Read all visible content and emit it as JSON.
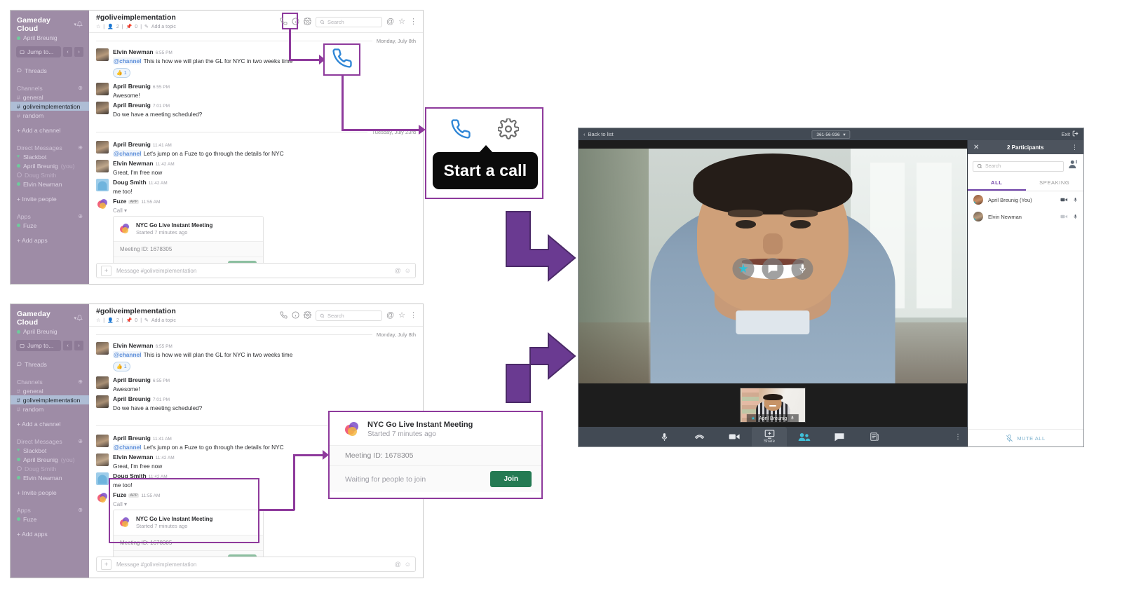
{
  "slack": {
    "team_name": "Gameday Cloud",
    "team_caret": "▾",
    "bell_icon": "🔔",
    "current_user": "April Breunig",
    "jump_placeholder": "Jump to...",
    "nav_prev": "‹",
    "nav_next": "›",
    "threads_label": "Threads",
    "sections": {
      "channels_label": "Channels",
      "channels": [
        {
          "hash": "#",
          "label": "general",
          "active": false
        },
        {
          "hash": "#",
          "label": "goliveimplementation",
          "active": true
        },
        {
          "hash": "#",
          "label": "random",
          "active": false
        }
      ],
      "add_channel": "+ Add a channel",
      "dm_label": "Direct Messages",
      "dms": [
        {
          "label": "Slackbot",
          "state": "heart"
        },
        {
          "label": "April Breunig",
          "suffix": "(you)",
          "state": "online"
        },
        {
          "label": "Doug Smith",
          "state": "away"
        },
        {
          "label": "Elvin Newman",
          "state": "online"
        }
      ],
      "invite_people": "+ Invite people",
      "apps_label": "Apps",
      "apps": [
        {
          "label": "Fuze",
          "state": "online"
        }
      ],
      "add_apps": "+ Add apps"
    },
    "channel": {
      "title": "#goliveimplementation",
      "members_icon": "☆",
      "member_count": "2",
      "pin_count": "0",
      "add_topic": "Add a topic",
      "search_placeholder": "Search",
      "call_icon": "phone-icon",
      "info_icon": "info-icon",
      "gear_icon": "gear-icon",
      "at_icon": "@",
      "star_icon": "☆",
      "kebab_icon": "⋮"
    },
    "day_dividers": {
      "first": "Monday, July 8th",
      "second": "Tuesday, July 23rd"
    },
    "messages_day1": [
      {
        "author": "Elvin Newman",
        "time": "6:55 PM",
        "mention": "@channel",
        "text": "This is how we will plan the GL for NYC in two weeks time",
        "reaction": {
          "emoji": "👍",
          "count": "1"
        }
      },
      {
        "author": "April Breunig",
        "time": "6:55 PM",
        "text": "Awesome!"
      },
      {
        "author": "April Breunig",
        "time": "7:01 PM",
        "text": "Do we have a meeting scheduled?"
      }
    ],
    "messages_day2": [
      {
        "author": "April Breunig",
        "time": "11:41 AM",
        "mention": "@channel",
        "text": "Let's jump on a Fuze to go through the details for NYC"
      },
      {
        "author": "Elvin Newman",
        "time": "11:42 AM",
        "text": "Great, I'm free now"
      },
      {
        "author": "Doug Smith",
        "time": "11:42 AM",
        "text": "me too!"
      },
      {
        "author": "Fuze",
        "app_tag": "APP",
        "time": "11:55 AM",
        "text": ""
      }
    ],
    "call_label": "Call ▾",
    "fuze_card": {
      "title": "NYC Go Live Instant Meeting",
      "subtitle": "Started 7 minutes ago",
      "meeting_id_label": "Meeting ID: 1678305",
      "waiting_label": "Waiting for people to join",
      "join_label": "Join"
    },
    "composer": {
      "placeholder": "Message #goliveimplementation",
      "plus": "+",
      "at": "@",
      "emoji": "☺"
    }
  },
  "callouts": {
    "tooltip_text": "Start a call",
    "tooltip_phone_icon": "phone-icon",
    "tooltip_gear_icon": "gear-icon",
    "zoom_phone_icon": "phone-icon"
  },
  "fuze_app": {
    "back_to_list": "Back to list",
    "back_chevron": "‹",
    "meeting_code": "361-56-936",
    "meeting_code_caret": "▾",
    "exit_label": "Exit",
    "exit_icon": "exit-icon",
    "stage_controls": [
      {
        "name": "favorite-star-button",
        "icon": "★"
      },
      {
        "name": "chat-bubble-button",
        "icon": "chat-icon"
      },
      {
        "name": "mic-button",
        "icon": "mic-icon"
      }
    ],
    "thumbnail": {
      "name": "April Breunig",
      "star": "★",
      "mic_icon": "mic-icon"
    },
    "toolbar": [
      {
        "name": "mic-toolbar-button",
        "icon": "mic-icon",
        "label": ""
      },
      {
        "name": "hangup-toolbar-button",
        "icon": "hangup-icon",
        "label": ""
      },
      {
        "name": "camera-toolbar-button",
        "icon": "camera-icon",
        "label": ""
      },
      {
        "name": "share-toolbar-button",
        "icon": "share-icon",
        "label": "Share"
      },
      {
        "name": "participants-toolbar-button",
        "icon": "people-icon",
        "label": ""
      },
      {
        "name": "chat-toolbar-button",
        "icon": "chat-icon",
        "label": ""
      },
      {
        "name": "notes-toolbar-button",
        "icon": "notes-icon",
        "label": ""
      }
    ],
    "toolbar_kebab": "⋮",
    "panel": {
      "title": "2 Participants",
      "close_icon": "✕",
      "kebab_icon": "⋮",
      "search_placeholder": "Search",
      "add_person_icon": "add-person-icon",
      "tabs": [
        {
          "label": "ALL",
          "active": true
        },
        {
          "label": "SPEAKING",
          "active": false
        }
      ],
      "participants": [
        {
          "name": "April Breunig (You)",
          "video": "on",
          "mic": "on"
        },
        {
          "name": "Elvin Newman",
          "video": "off",
          "mic": "on"
        }
      ],
      "mute_all": "MUTE ALL",
      "mute_all_icon": "mic-off-icon"
    }
  },
  "colors": {
    "slack_sidebar": "#9e8ca6",
    "slack_active": "#aebdd5",
    "accent_purple": "#8e3a9c",
    "big_arrow": "#6a3a91",
    "join_green_small": "#8cbfa0",
    "join_green_large": "#247a53",
    "fuze_chrome": "#424a54",
    "tab_purple": "#6f42a8",
    "mute_blue": "#7fb3cf"
  }
}
